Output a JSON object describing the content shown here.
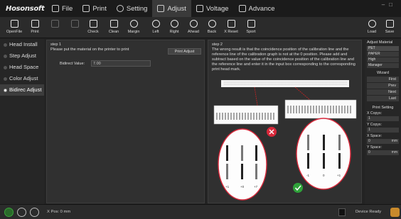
{
  "app": {
    "logo": "Hosonsoft"
  },
  "menu": [
    {
      "label": "File",
      "icon": "file-icon"
    },
    {
      "label": "Print",
      "icon": "printer-icon"
    },
    {
      "label": "Setting",
      "icon": "gear-icon"
    },
    {
      "label": "Adjust",
      "icon": "adjust-icon"
    },
    {
      "label": "Voltage",
      "icon": "voltage-icon"
    },
    {
      "label": "Advance",
      "icon": "advance-icon"
    }
  ],
  "toolbar": {
    "open_file": "OpenFile",
    "print": "Print",
    "check": "Check",
    "clean": "Clean",
    "margin": "Margin",
    "left": "Left",
    "right": "Right",
    "ahead": "Ahead",
    "back": "Back",
    "x_reset": "X Reset",
    "sport": "Sport",
    "load": "Load",
    "save": "Save"
  },
  "sidebar": {
    "items": [
      {
        "label": "Head Install"
      },
      {
        "label": "Step Adjust"
      },
      {
        "label": "Head Space"
      },
      {
        "label": "Color Adjust"
      },
      {
        "label": "Bidirec Adjust"
      }
    ]
  },
  "step1": {
    "title": "step 1",
    "text": "Please put the material on the printer to print",
    "print_button": "Print Adjust",
    "bidirec_label": "Bidirect Value:",
    "bidirec_value": "7.00"
  },
  "step2": {
    "title": "step 2",
    "text": "The wrong result is that the coincidence position of the calibration line and the reference line of the calibration graph is not at the 0 position. Please add and subtract based on the value of the coincidence position of the calibration line and the reference line and enter it in the input box corresponding to the corresponding print head mark.",
    "wrong_labels": [
      "+1",
      "+0",
      "+7"
    ],
    "right_labels": [
      "-1",
      "0",
      "+1"
    ]
  },
  "right_panel": {
    "title": "Adjust Material",
    "materials": [
      "PET",
      "PAPER",
      "High",
      "Manager"
    ],
    "wizard_title": "Wizard",
    "wizard_buttons": [
      "First",
      "Prev",
      "Next",
      "Last"
    ],
    "print_setting_title": "Print Setting",
    "x_copy_label": "X Copys:",
    "x_copy_value": "1",
    "y_copy_label": "Y Copys:",
    "y_copy_value": "1",
    "x_space_label": "X Space:",
    "x_space_value": "0",
    "y_space_label": "Y Space:",
    "y_space_value": "0",
    "unit": "mm"
  },
  "status": {
    "x_pos": "X Pos: 0 mm",
    "device": "Device Ready"
  },
  "colors": {
    "wrong": "#d8283a",
    "right": "#2fa23a",
    "arrow": "#cc2222"
  }
}
